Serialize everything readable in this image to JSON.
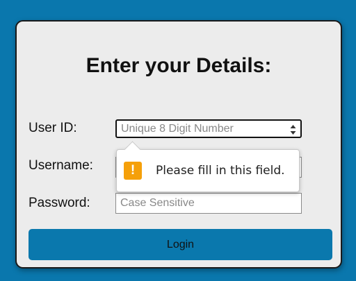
{
  "form": {
    "title": "Enter your Details:",
    "fields": [
      {
        "label": "User ID:",
        "placeholder": "Unique 8 Digit Number",
        "value": ""
      },
      {
        "label": "Username:",
        "placeholder": "",
        "value": ""
      },
      {
        "label": "Password:",
        "placeholder": "Case Sensitive",
        "value": ""
      }
    ],
    "login_label": "Login"
  },
  "validation_tooltip": {
    "icon": "warning-icon",
    "message": "Please fill in this field."
  },
  "colors": {
    "page_background": "#0a77ad",
    "card_background": "#ececec",
    "button_background": "#0a78ad",
    "warning": "#f5a00a"
  }
}
